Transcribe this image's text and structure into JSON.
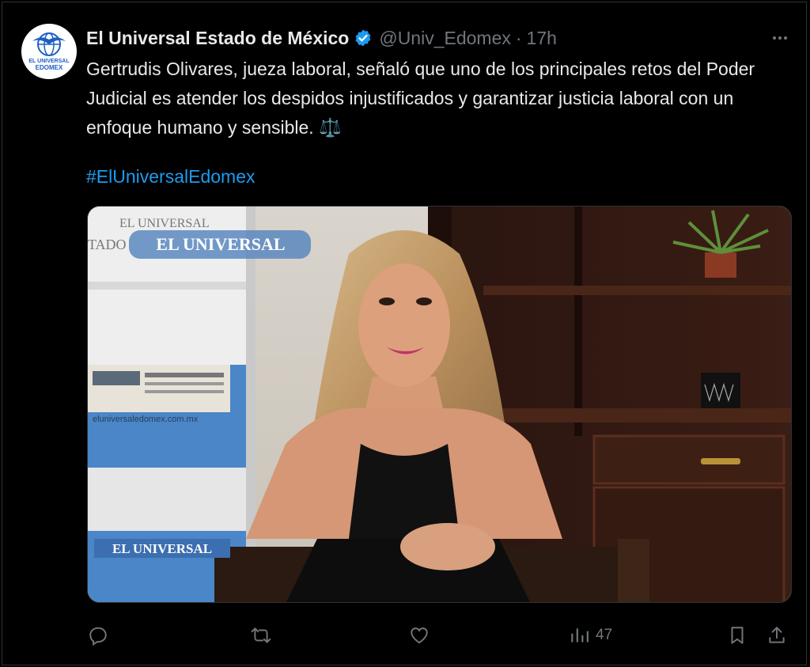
{
  "account": {
    "display_name": "El Universal Estado de México",
    "handle": "@Univ_Edomex",
    "separator": "·",
    "time": "17h",
    "avatar_text_line1": "EL UNIVERSAL",
    "avatar_text_line2": "EDOMEX"
  },
  "tweet": {
    "text": "Gertrudis Olivares, jueza laboral, señaló que uno de los principales retos del Poder Judicial es atender los despidos injustificados y garantizar justicia laboral con un enfoque humano y sensible. ⚖️",
    "hashtag": "#ElUniversalEdomex"
  },
  "media": {
    "banner_text": "EL UNIVERSAL",
    "banner_top_left": "EL UNIVERSAL",
    "banner_top_left_2": "TADO",
    "website_text": "eluniversaledomex.com.mx",
    "logo_bottom": "EL UNIVERSAL"
  },
  "actions": {
    "reply_icon": "reply-icon",
    "retweet_icon": "retweet-icon",
    "like_icon": "heart-icon",
    "views_icon": "views-icon",
    "views_count": "47",
    "bookmark_icon": "bookmark-icon",
    "share_icon": "share-icon"
  },
  "colors": {
    "background": "#000000",
    "text": "#e7e9ea",
    "muted": "#71767b",
    "link": "#1d9bf0",
    "verified": "#1d9bf0"
  }
}
